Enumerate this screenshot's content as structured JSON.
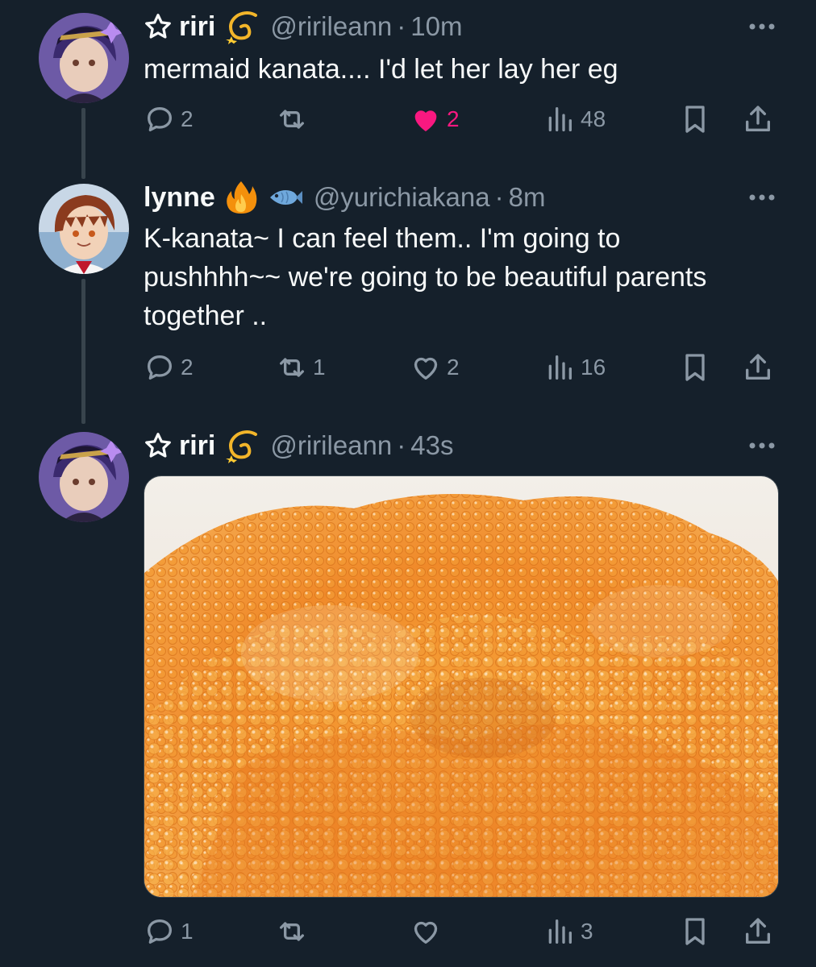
{
  "tweets": [
    {
      "display_name": "riri",
      "name_prefix_icon": "star-outline-icon",
      "emojis": [
        "dizzy-emoji"
      ],
      "handle": "@ririleann",
      "separator": "·",
      "time": "10m",
      "text": "mermaid kanata.... I'd let her lay her eg",
      "actions": {
        "replies": "2",
        "reposts": "",
        "likes": "2",
        "liked": true,
        "views": "48"
      }
    },
    {
      "display_name": "lynne",
      "emojis": [
        "fire-emoji",
        "fish-emoji"
      ],
      "handle": "@yurichiakana",
      "separator": "·",
      "time": "8m",
      "text": "K-kanata~ I can feel them.. I'm going to pushhhh~~ we're going to be beautiful parents together ..",
      "actions": {
        "replies": "2",
        "reposts": "1",
        "likes": "2",
        "liked": false,
        "views": "16"
      }
    },
    {
      "display_name": "riri",
      "name_prefix_icon": "star-outline-icon",
      "emojis": [
        "dizzy-emoji"
      ],
      "handle": "@ririleann",
      "separator": "·",
      "time": "43s",
      "media": "fish-roe-photo",
      "actions": {
        "replies": "1",
        "reposts": "",
        "likes": "",
        "liked": false,
        "views": "3"
      }
    }
  ],
  "colors": {
    "background": "#15202b",
    "text_primary": "#f7f9f9",
    "text_secondary": "#8b98a5",
    "like_active": "#f91880",
    "thread_line": "#38444d"
  }
}
